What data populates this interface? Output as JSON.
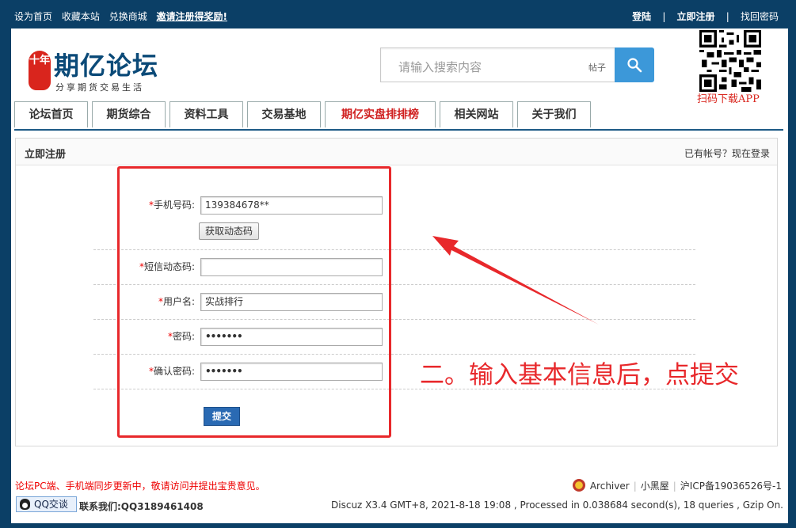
{
  "topbar": {
    "set_home": "设为首页",
    "bookmark": "收藏本站",
    "exchange": "兑换商城",
    "invite": "邀请注册得奖励!",
    "login": "登陆",
    "register": "立即注册",
    "find_password": "找回密码",
    "separator": "|"
  },
  "logo": {
    "seal_text": "十年",
    "name": "期亿论坛",
    "slogan": "分享期货交易生活"
  },
  "search": {
    "placeholder": "请输入搜索内容",
    "scope": "帖子",
    "button_icon": "search-icon"
  },
  "qr": {
    "caption": "扫码下载APP"
  },
  "nav": {
    "tabs": [
      {
        "label": "论坛首页"
      },
      {
        "label": "期货综合"
      },
      {
        "label": "资料工具"
      },
      {
        "label": "交易基地"
      },
      {
        "label": "期亿实盘排排榜"
      },
      {
        "label": "相关网站"
      },
      {
        "label": "关于我们"
      }
    ]
  },
  "panel": {
    "title": "立即注册",
    "login_prompt": "已有帐号？现在登录"
  },
  "form": {
    "required_mark": "*",
    "phone_label": "手机号码:",
    "phone_value": "139384678**",
    "get_code_button": "获取动态码",
    "sms_label": "短信动态码:",
    "sms_value": "",
    "username_label": "用户名:",
    "username_value": "实战排行",
    "password_label": "密码:",
    "password_value": "•••••••",
    "confirm_label": "确认密码:",
    "confirm_value": "•••••••",
    "submit": "提交"
  },
  "annotation": {
    "text": "二。输入基本信息后，点提交",
    "color": "#e8282b"
  },
  "footer": {
    "notice": "论坛PC端、手机端同步更新中，敬请访问并提出宝贵意见。",
    "archiver": "Archiver",
    "xiaoheiwu": "小黑屋",
    "icp": "沪ICP备19036526号-1",
    "separator": "|",
    "qq_button": "QQ交谈",
    "contact": "联系我们:QQ3189461408",
    "powered": "Discuz X3.4 GMT+8, 2021-8-18 19:08 , Processed in 0.038684 second(s), 18 queries , Gzip On."
  },
  "colors": {
    "brand_navy": "#0b3f66",
    "accent_blue": "#3c98d9",
    "alert_red": "#e8282b"
  }
}
